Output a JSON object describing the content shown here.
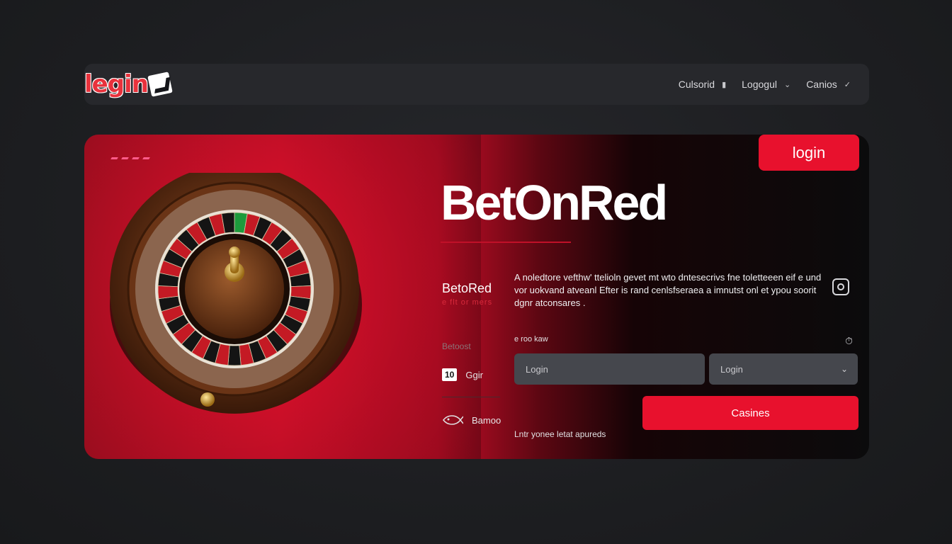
{
  "nav": {
    "logo_text": "legin",
    "items": [
      {
        "label": "Culsorid",
        "icon": "lock-icon"
      },
      {
        "label": "Logogul",
        "icon": "chevron-down-icon"
      },
      {
        "label": "Canios",
        "icon": "check-icon"
      }
    ]
  },
  "hero": {
    "login_button": "login",
    "title": "BetOnRed",
    "sidebar": {
      "name": "BetoRed",
      "sub": "e flt or mers",
      "label": "Betoost",
      "badge": "10",
      "row1": "Ggir",
      "row2": "Bamoo"
    },
    "description": "A noledtore vefthw' ttelioln gevet mt wto dntesecrivs fne toletteeen eif e und vor uokvand atveanl Efter is rand cenlsfseraea a imnutst onl et ypou soorit dgnr atconsares .",
    "field_label": "e roo kaw",
    "input_placeholder": "Login",
    "select_value": "Login",
    "cta_label": "Casines",
    "footnote": "Lntr yonee letat apureds"
  },
  "colors": {
    "accent": "#e8112d",
    "bg": "#1d1e21"
  }
}
